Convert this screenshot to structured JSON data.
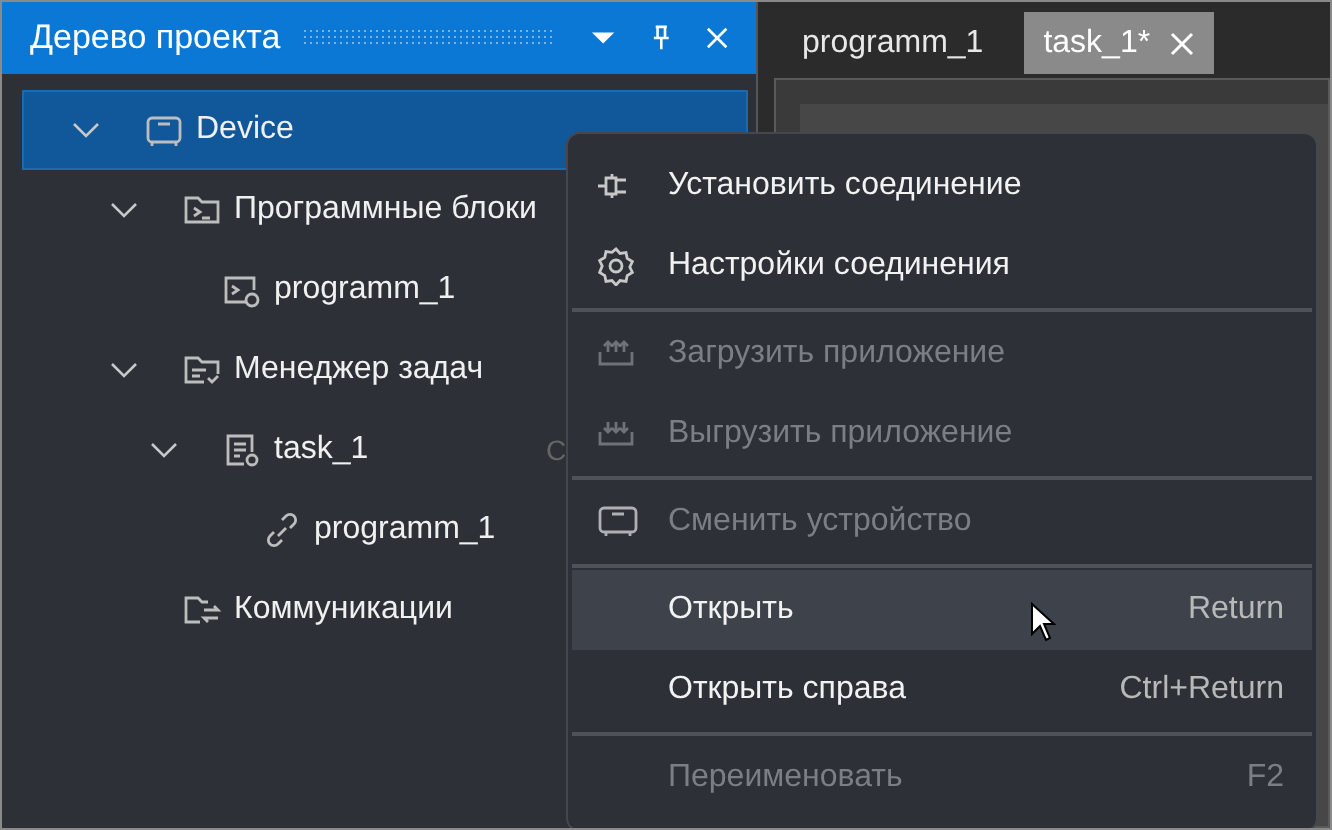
{
  "panel": {
    "title": "Дерево проекта"
  },
  "tree": [
    {
      "label": "Device",
      "selected": true,
      "expanded": true,
      "children": [
        {
          "label": "Программные блоки",
          "selected": false,
          "expanded": true,
          "children": [
            {
              "label": "programm_1",
              "selected": false
            }
          ]
        },
        {
          "label": "Менеджер задач",
          "selected": false,
          "expanded": true,
          "children": [
            {
              "label": "task_1",
              "count": "С",
              "selected": false,
              "expanded": true,
              "children": [
                {
                  "label": "programm_1",
                  "selected": false
                }
              ]
            }
          ]
        },
        {
          "label": "Коммуникации",
          "selected": false
        }
      ]
    }
  ],
  "tabs": [
    {
      "label": "programm_1",
      "selected": false
    },
    {
      "label": "task_1*",
      "selected": true
    }
  ],
  "context_menu": [
    {
      "kind": "item",
      "label": "Установить соединение",
      "disabled": false,
      "selected": false
    },
    {
      "kind": "item",
      "label": "Настройки соединения",
      "disabled": false,
      "selected": false
    },
    {
      "kind": "separator"
    },
    {
      "kind": "item",
      "label": "Загрузить приложение",
      "disabled": true,
      "selected": false
    },
    {
      "kind": "item",
      "label": "Выгрузить приложение",
      "disabled": true,
      "selected": false
    },
    {
      "kind": "separator"
    },
    {
      "kind": "item",
      "label": "Сменить устройство",
      "disabled": true,
      "selected": false
    },
    {
      "kind": "separator"
    },
    {
      "kind": "item",
      "label": "Открыть",
      "shortcut": "Return",
      "disabled": false,
      "selected": true
    },
    {
      "kind": "item",
      "label": "Открыть справа",
      "shortcut": "Ctrl+Return",
      "disabled": false,
      "selected": false
    },
    {
      "kind": "separator"
    },
    {
      "kind": "item",
      "label": "Переименовать",
      "shortcut": "F2",
      "disabled": true,
      "selected": false
    }
  ]
}
